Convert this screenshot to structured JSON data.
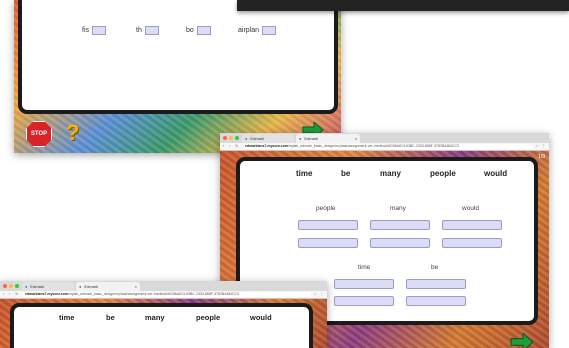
{
  "top_frame": {
    "words": [
      "fis",
      "th",
      "bo",
      "airplan"
    ],
    "stop_label": "STOP",
    "help_label": "?"
  },
  "browser_mid": {
    "tabs": [
      {
        "label": "Edmark"
      },
      {
        "label": "Edmark"
      }
    ],
    "url_host": "edmarklans7.mysonr.com",
    "url_path": "/mylab_edmark_basic_design/my/dashassignment-ver-/mmlhub/6CB6A613-63BC-2333-888F-3782B4484CC3",
    "header_words": [
      "time",
      "be",
      "many",
      "people",
      "would"
    ],
    "columns": [
      "people",
      "many",
      "would"
    ],
    "lower_labels": [
      "time",
      "be"
    ],
    "counter": "1/9"
  },
  "browser_bot": {
    "tabs": [
      {
        "label": "Edmark"
      },
      {
        "label": "Edmark"
      }
    ],
    "url_host": "edmarklans7.mysonr.com",
    "url_path": "/mylab_edmark_basic_design/my/dashassignment-ver-/mmlhub/6CB6A613-63BC-2333-888F-3782B4484CC3",
    "header_words": [
      "time",
      "be",
      "many",
      "people",
      "would"
    ]
  },
  "colors": {
    "blank_fill": "#dcdcf6",
    "next_arrow": "#1e9d3a",
    "stop": "#d8232a",
    "help": "#f4b400"
  },
  "icons": [
    "stop-sign-icon",
    "question-mark-icon",
    "next-arrow-icon",
    "reload-icon",
    "star-icon"
  ]
}
